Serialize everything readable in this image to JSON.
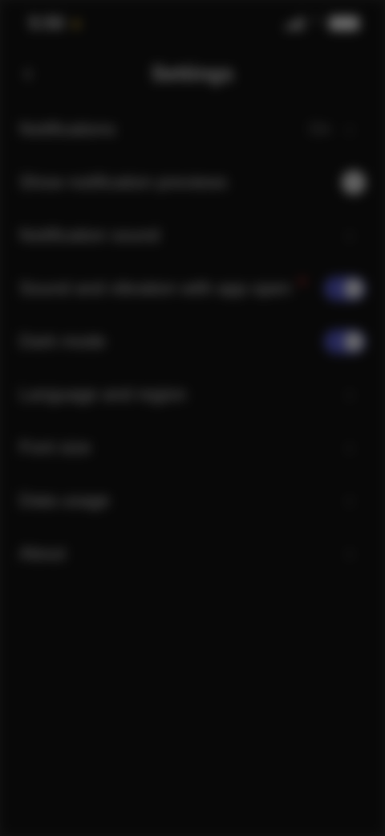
{
  "status_bar": {
    "time": "5:50"
  },
  "header": {
    "title": "Settings",
    "back_label": "‹"
  },
  "settings": {
    "rows": [
      {
        "label": "Notifications",
        "value": "On",
        "control": "chevron"
      },
      {
        "label": "Show notification previews",
        "control": "circle"
      },
      {
        "label": "Notification sound",
        "control": "chevron"
      },
      {
        "label": "Sound and vibration with app open",
        "badge": true,
        "control": "toggle",
        "toggle_on": true
      },
      {
        "label": "Dark mode",
        "control": "toggle",
        "toggle_on": true
      },
      {
        "label": "Language and region",
        "control": "chevron"
      },
      {
        "label": "Font size",
        "control": "chevron"
      },
      {
        "label": "Data usage",
        "control": "chevron"
      },
      {
        "label": "About",
        "control": "chevron"
      }
    ]
  },
  "colors": {
    "background": "#131313",
    "toggle_on": "#5b5fd6",
    "badge": "#e03030",
    "status_dot": "#c9a437"
  }
}
